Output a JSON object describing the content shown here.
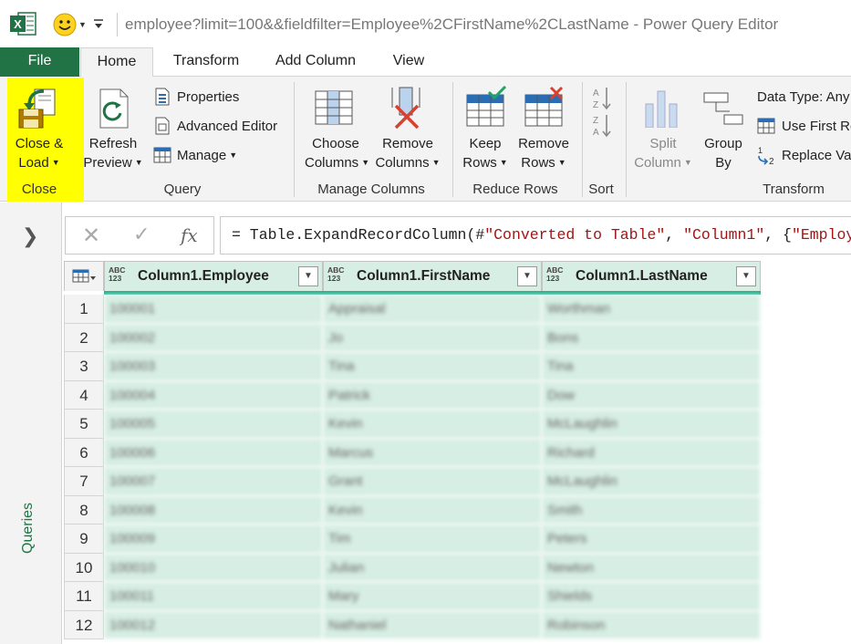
{
  "window": {
    "title": "employee?limit=100&&fieldfilter=Employee%2CFirstName%2CLastName - Power Query Editor",
    "icons": [
      "excel-app-icon",
      "smiley-feedback-icon",
      "quick-access-dropdown-icon"
    ]
  },
  "tabs": [
    "File",
    "Home",
    "Transform",
    "Add Column",
    "View"
  ],
  "ribbon": {
    "close_load_1": "Close &",
    "close_load_2": "Load",
    "close_group": "Close",
    "refresh_1": "Refresh",
    "refresh_2": "Preview",
    "properties": "Properties",
    "advanced_editor": "Advanced Editor",
    "manage": "Manage",
    "query_group": "Query",
    "choose_1": "Choose",
    "choose_2": "Columns",
    "remove_1": "Remove",
    "remove_2": "Columns",
    "manage_cols_group": "Manage Columns",
    "keep_1": "Keep",
    "keep_2": "Rows",
    "remove_rows_1": "Remove",
    "remove_rows_2": "Rows",
    "reduce_group": "Reduce Rows",
    "sort_group": "Sort",
    "split_1": "Split",
    "split_2": "Column",
    "group_1": "Group",
    "group_2": "By",
    "data_type": "Data Type: Any",
    "use_first": "Use First Ro",
    "replace": "Replace Va",
    "transform_group": "Transform",
    "highlight_color": "#ffff00"
  },
  "left_pane": {
    "label": "Queries"
  },
  "formula": {
    "prefix": "= Table.ExpandRecordColumn(#",
    "s1": "\"Converted to Table\"",
    "mid": ", ",
    "s2": "\"Column1\"",
    "mid2": ", {",
    "s3": "\"Employ"
  },
  "table": {
    "columns": [
      {
        "type_top": "ABC",
        "type_bottom": "123",
        "name": "Column1.Employee"
      },
      {
        "type_top": "ABC",
        "type_bottom": "123",
        "name": "Column1.FirstName"
      },
      {
        "type_top": "ABC",
        "type_bottom": "123",
        "name": "Column1.LastName"
      }
    ],
    "rows": [
      {
        "n": "1",
        "a": "100001",
        "b": "Appraisal",
        "c": "Worthman"
      },
      {
        "n": "2",
        "a": "100002",
        "b": "Jo",
        "c": "Bons"
      },
      {
        "n": "3",
        "a": "100003",
        "b": "Tina",
        "c": "Tina"
      },
      {
        "n": "4",
        "a": "100004",
        "b": "Patrick",
        "c": "Dow"
      },
      {
        "n": "5",
        "a": "100005",
        "b": "Kevin",
        "c": "McLaughlin"
      },
      {
        "n": "6",
        "a": "100006",
        "b": "Marcus",
        "c": "Richard"
      },
      {
        "n": "7",
        "a": "100007",
        "b": "Grant",
        "c": "McLaughlin"
      },
      {
        "n": "8",
        "a": "100008",
        "b": "Kevin",
        "c": "Smith"
      },
      {
        "n": "9",
        "a": "100009",
        "b": "Tim",
        "c": "Peters"
      },
      {
        "n": "10",
        "a": "100010",
        "b": "Julian",
        "c": "Newton"
      },
      {
        "n": "11",
        "a": "100011",
        "b": "Mary",
        "c": "Shields"
      },
      {
        "n": "12",
        "a": "100012",
        "b": "Nathaniel",
        "c": "Robinson"
      }
    ],
    "accent_color": "#1fb08a",
    "cell_color": "#d6eee3"
  }
}
